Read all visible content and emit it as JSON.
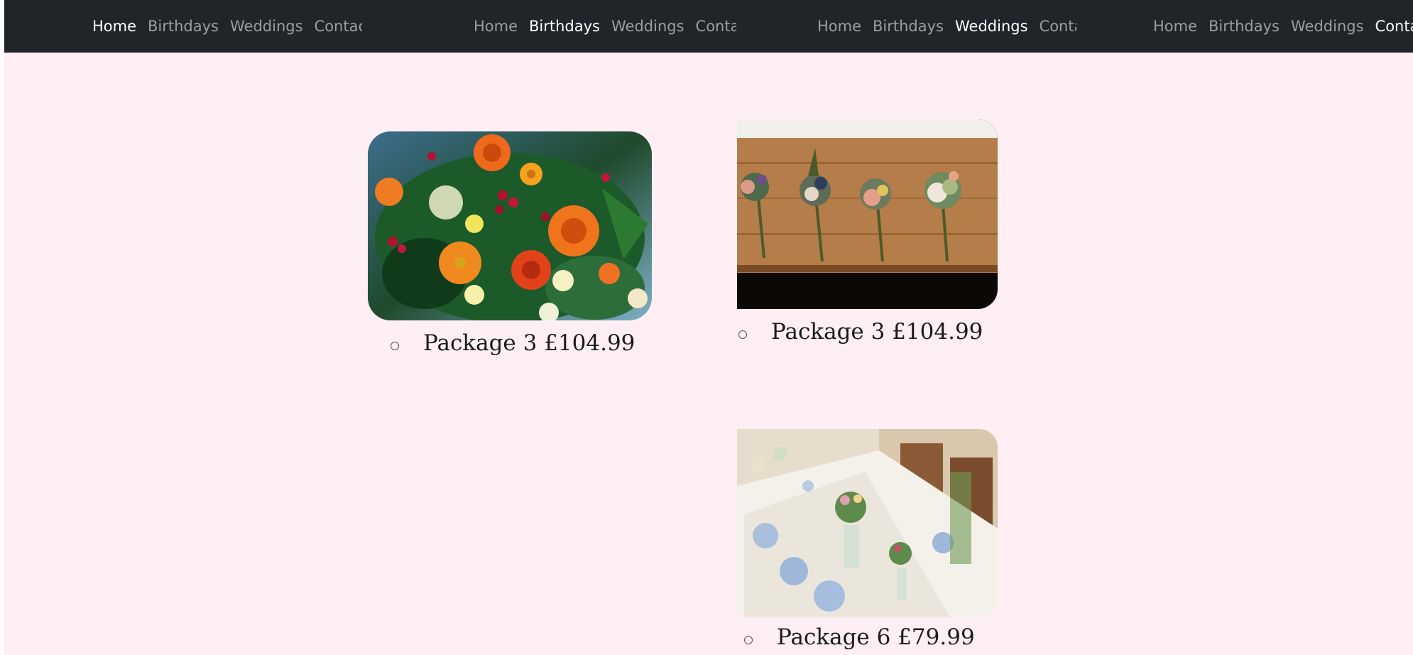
{
  "nav_groups": [
    {
      "items": [
        "Home",
        "Birthdays",
        "Weddings",
        "Contact"
      ],
      "active": "Home"
    },
    {
      "items": [
        "Home",
        "Birthdays",
        "Weddings",
        "Contact"
      ],
      "active": "Birthdays"
    },
    {
      "items": [
        "Home",
        "Birthdays",
        "Weddings",
        "Contact"
      ],
      "active": "Weddings"
    },
    {
      "items": [
        "Home",
        "Birthdays",
        "Weddings",
        "Contact"
      ],
      "active": "Contact"
    }
  ],
  "cards": [
    {
      "caption": "Package 3 £104.99",
      "image": "bouquet-photo"
    },
    {
      "caption": "Package 3 £104.99",
      "image": "boutonnieres-photo"
    },
    {
      "caption": "Package 6 £79.99",
      "image": "wedding-table-photo"
    }
  ]
}
